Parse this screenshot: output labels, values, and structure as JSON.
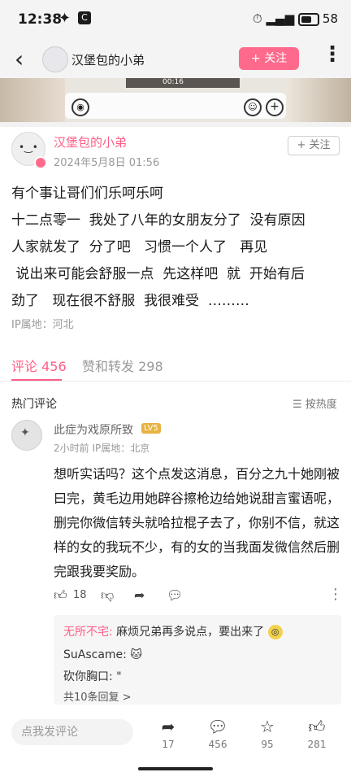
{
  "status_bar": {
    "time": "12:38",
    "battery": "58"
  },
  "header": {
    "title": "汉堡包的小弟",
    "follow_label": "+ 关注"
  },
  "media": {
    "duration": "00:16"
  },
  "post": {
    "author": "汉堡包的小弟",
    "date": "2024年5月8日 01:56",
    "follow_label": "+ 关注",
    "text": "有个事让哥们们乐呵乐呵\n十二点零一  我处了八年的女朋友分了  没有原因\n人家就发了  分了吧   习惯一个人了   再见\n 说出来可能会舒服一点  先这样吧  就  开始有后\n劲了   现在很不舒服  我很难受  ………",
    "ip": "IP属地：河北"
  },
  "tabs": {
    "comments": "评论 456",
    "likes_reposts": "赞和转发 298"
  },
  "hot_comments": {
    "title": "热门评论",
    "sort": "按热度"
  },
  "comment": {
    "name": "此症为戏原所致",
    "level": "LV5",
    "meta": "2小时前  IP属地：北京",
    "text": "想听实话吗？这个点发这消息，百分之九十她刚被曰完，黄毛边用她辟谷擦枪边给她说甜言蜜语呢，删完你微信转头就哈拉棍子去了，你别不信，就这样的女的我玩不少，有的女的当我面发微信然后删完跟我要奖励。",
    "like_count": "18"
  },
  "replies": {
    "r1_name": "无所不宅:",
    "r1_text": " 麻烦兄弟再多说点，要出来了",
    "r2_name": "SuAscame:",
    "r3_name": "砍你胸口:",
    "r3_text": " \"",
    "more": "共10条回复 >"
  },
  "bottom_bar": {
    "placeholder": "点我发评论",
    "share_count": "17",
    "comment_count": "456",
    "star_count": "95",
    "like_count": "281"
  }
}
